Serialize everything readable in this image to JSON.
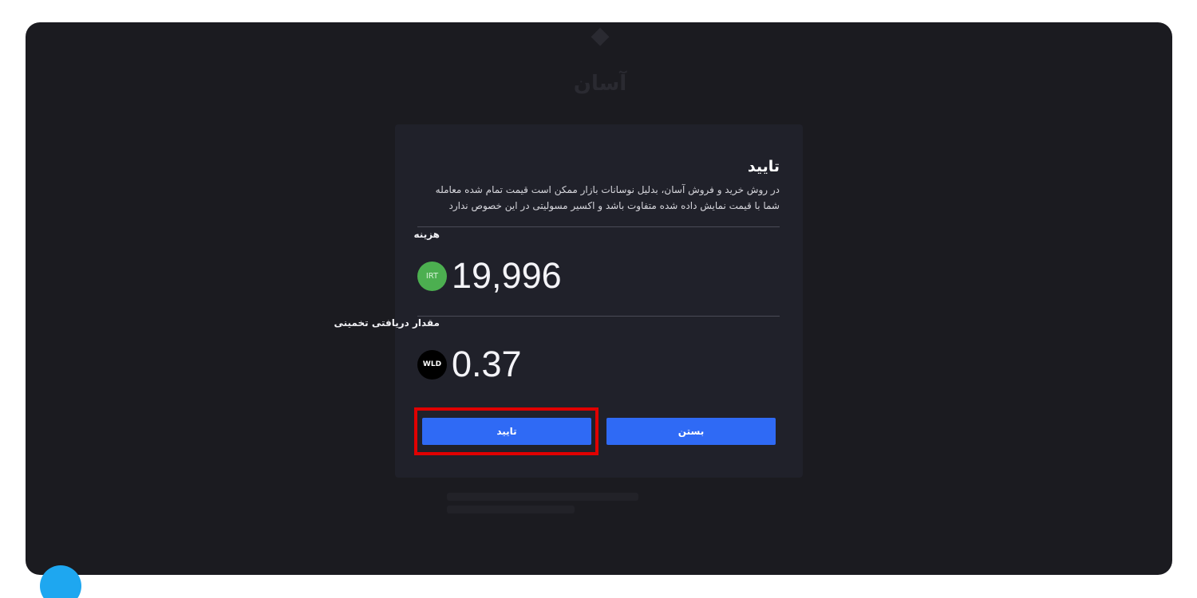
{
  "modal": {
    "title": "تایید",
    "description": "در روش خرید و فروش آسان، بدلیل نوسانات بازار ممکن است قیمت تمام شده معامله شما با قیمت نمایش داده شده متفاوت باشد و اکسیر مسولیتی در این خصوص ندارد",
    "cost": {
      "label": "هزینه",
      "value": "19,996",
      "currency_badge": "IRT",
      "currency_color": "#4caf50"
    },
    "estimated_receive": {
      "label": "مقدار دریافتی تخمینی",
      "value": "0.37",
      "currency_badge": "WLD",
      "currency_color": "#000000"
    },
    "buttons": {
      "confirm_label": "تایید",
      "close_label": "بستن",
      "color": "#2f6af5"
    }
  },
  "annotation": {
    "highlight_color": "#e00000"
  },
  "background": {
    "title": "آسان"
  }
}
